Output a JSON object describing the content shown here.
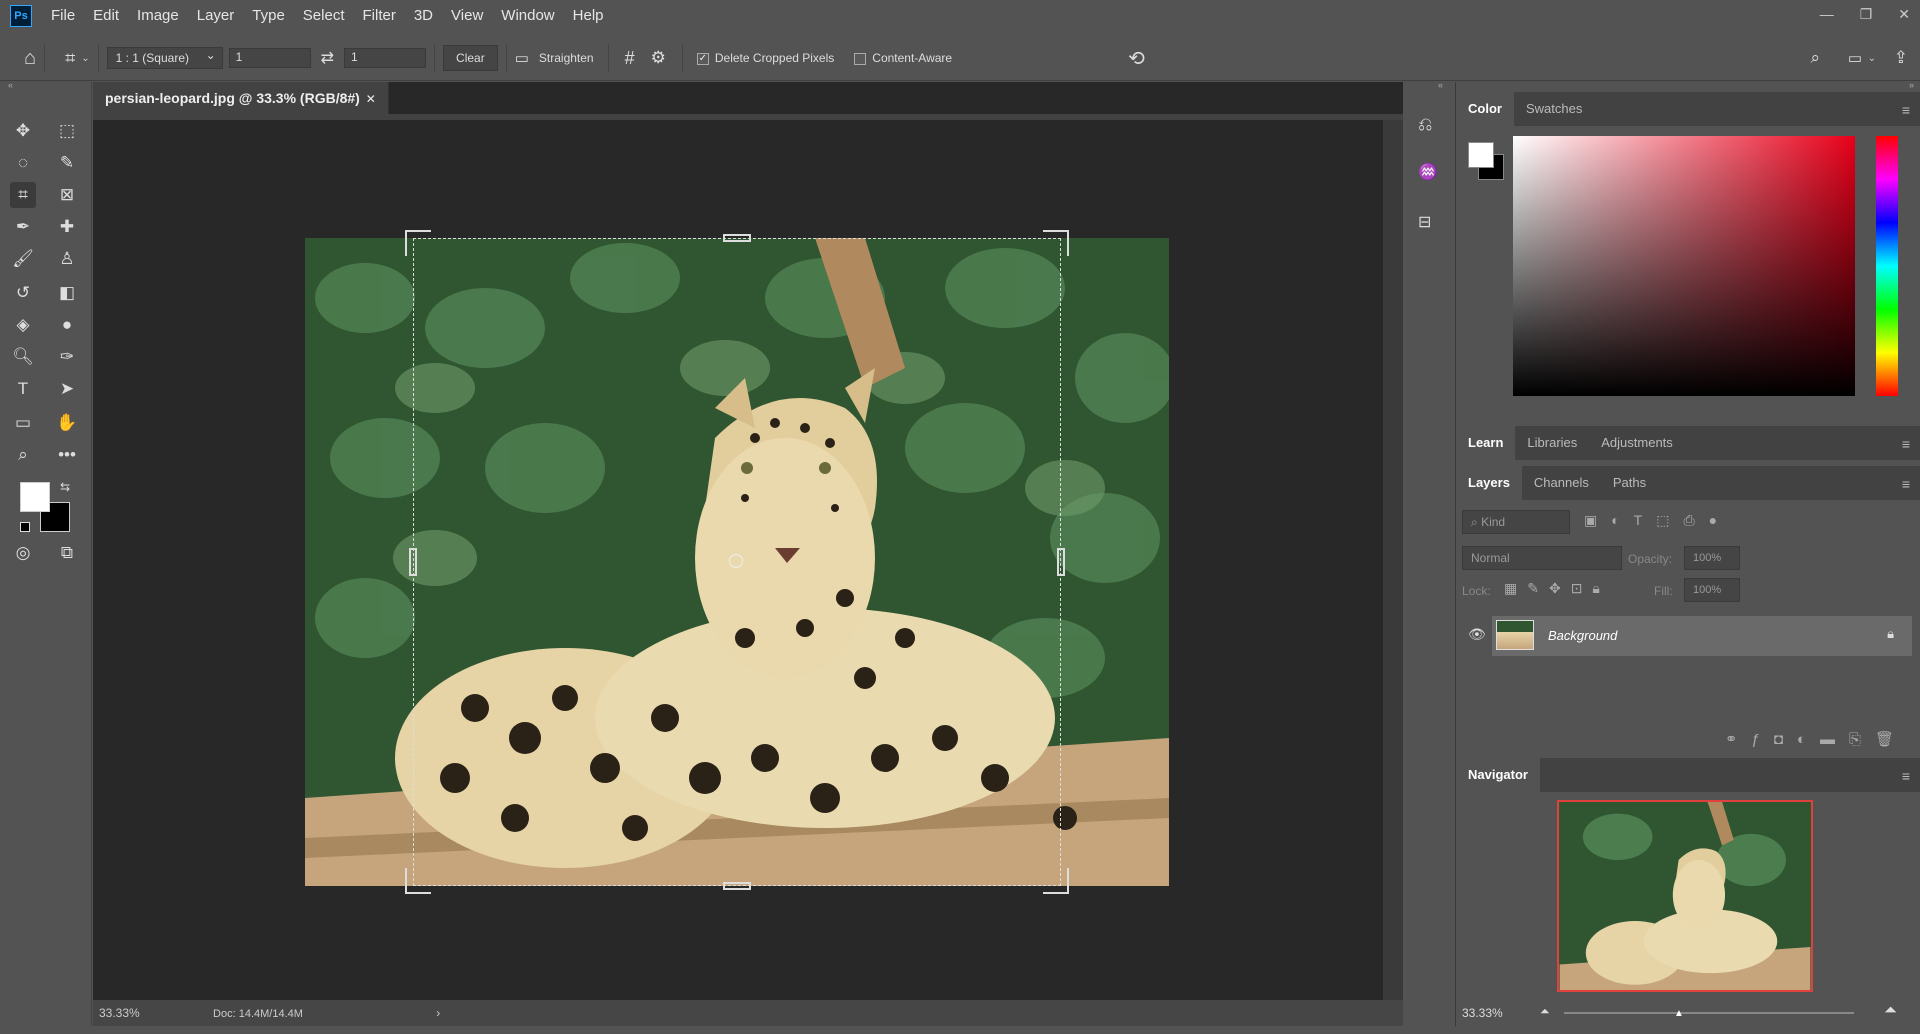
{
  "app": {
    "logo": "Ps"
  },
  "menu": [
    "File",
    "Edit",
    "Image",
    "Layer",
    "Type",
    "Select",
    "Filter",
    "3D",
    "View",
    "Window",
    "Help"
  ],
  "options": {
    "ratio": "1 : 1 (Square)",
    "width": "1",
    "height": "1",
    "clear": "Clear",
    "straighten": "Straighten",
    "delete_cropped": "Delete Cropped Pixels",
    "content_aware": "Content-Aware",
    "delete_cropped_checked": true,
    "content_aware_checked": false
  },
  "document": {
    "tab_title": "persian-leopard.jpg @ 33.3% (RGB/8#)",
    "zoom": "33.33%",
    "doc_info": "Doc: 14.4M/14.4M"
  },
  "color_panel": {
    "tabs": [
      "Color",
      "Swatches"
    ],
    "fg": "#ffffff",
    "bg": "#000000"
  },
  "learn_panel": {
    "tabs": [
      "Learn",
      "Libraries",
      "Adjustments"
    ]
  },
  "layers_panel": {
    "tabs": [
      "Layers",
      "Channels",
      "Paths"
    ],
    "kind": "Kind",
    "blend": "Normal",
    "opacity_label": "Opacity:",
    "opacity": "100%",
    "lock_label": "Lock:",
    "fill_label": "Fill:",
    "fill": "100%",
    "layer_name": "Background"
  },
  "navigator": {
    "title": "Navigator",
    "zoom": "33.33%"
  }
}
